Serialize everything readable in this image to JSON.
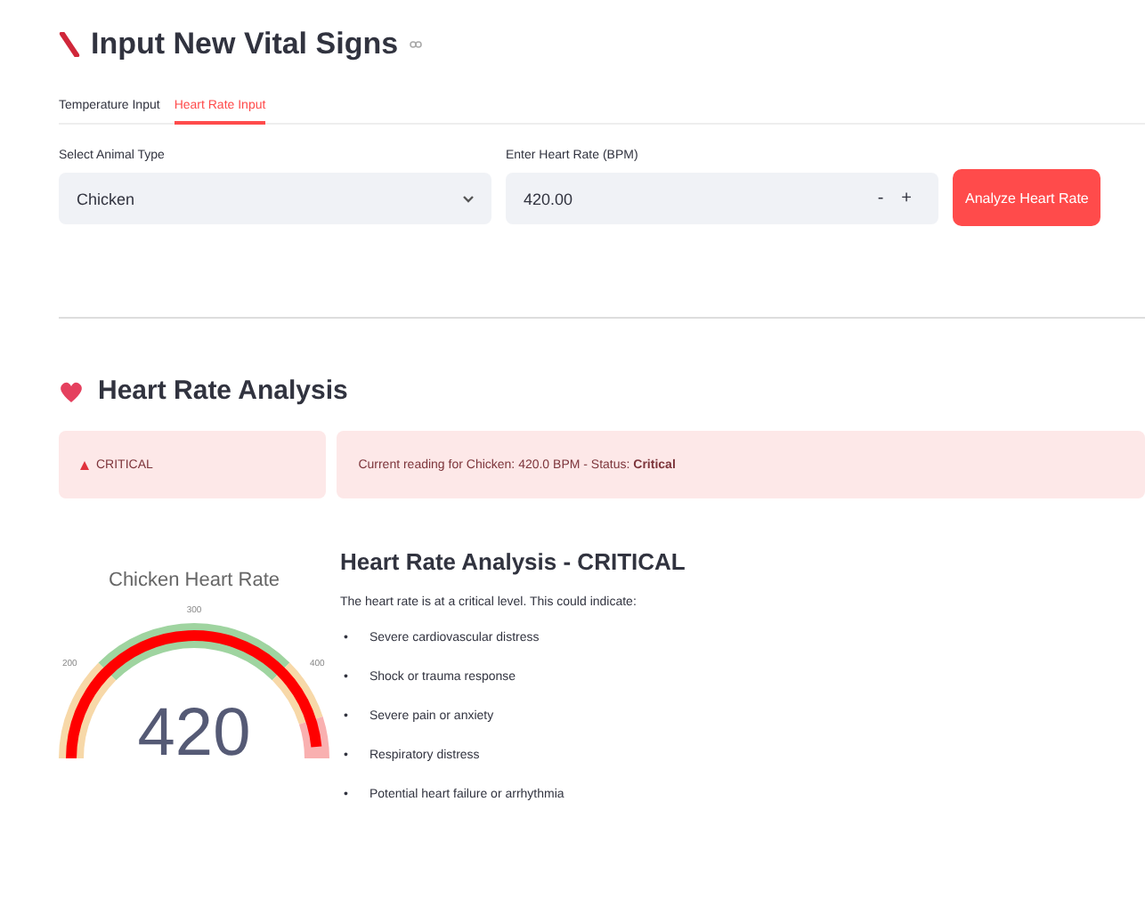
{
  "header": {
    "title": "Input New Vital Signs"
  },
  "tabs": [
    {
      "label": "Temperature Input",
      "selected": false
    },
    {
      "label": "Heart Rate Input",
      "selected": true
    }
  ],
  "animal_select": {
    "label": "Select Animal Type",
    "value": "Chicken"
  },
  "heart_rate_input": {
    "label": "Enter Heart Rate (BPM)",
    "value": "420.00",
    "decrement": "-",
    "increment": "+"
  },
  "analyze_button": "Analyze Heart Rate",
  "analysis": {
    "title": "Heart Rate Analysis",
    "status_badge": "CRITICAL",
    "reading": "Current reading for Chicken: 420.0 BPM - Status: **Critical**",
    "gauge": {
      "title": "Chicken Heart Rate",
      "value": "420",
      "ticks": [
        "200",
        "300",
        "400"
      ]
    },
    "report": {
      "title": "Heart Rate Analysis - CRITICAL",
      "intro": "The heart rate is at a critical level. This could indicate:",
      "bullet": "•",
      "items": [
        "Severe cardiovascular distress",
        "Shock or trauma response",
        "Severe pain or anxiety",
        "Respiratory distress",
        "Potential heart failure or arrhythmia"
      ]
    }
  }
}
